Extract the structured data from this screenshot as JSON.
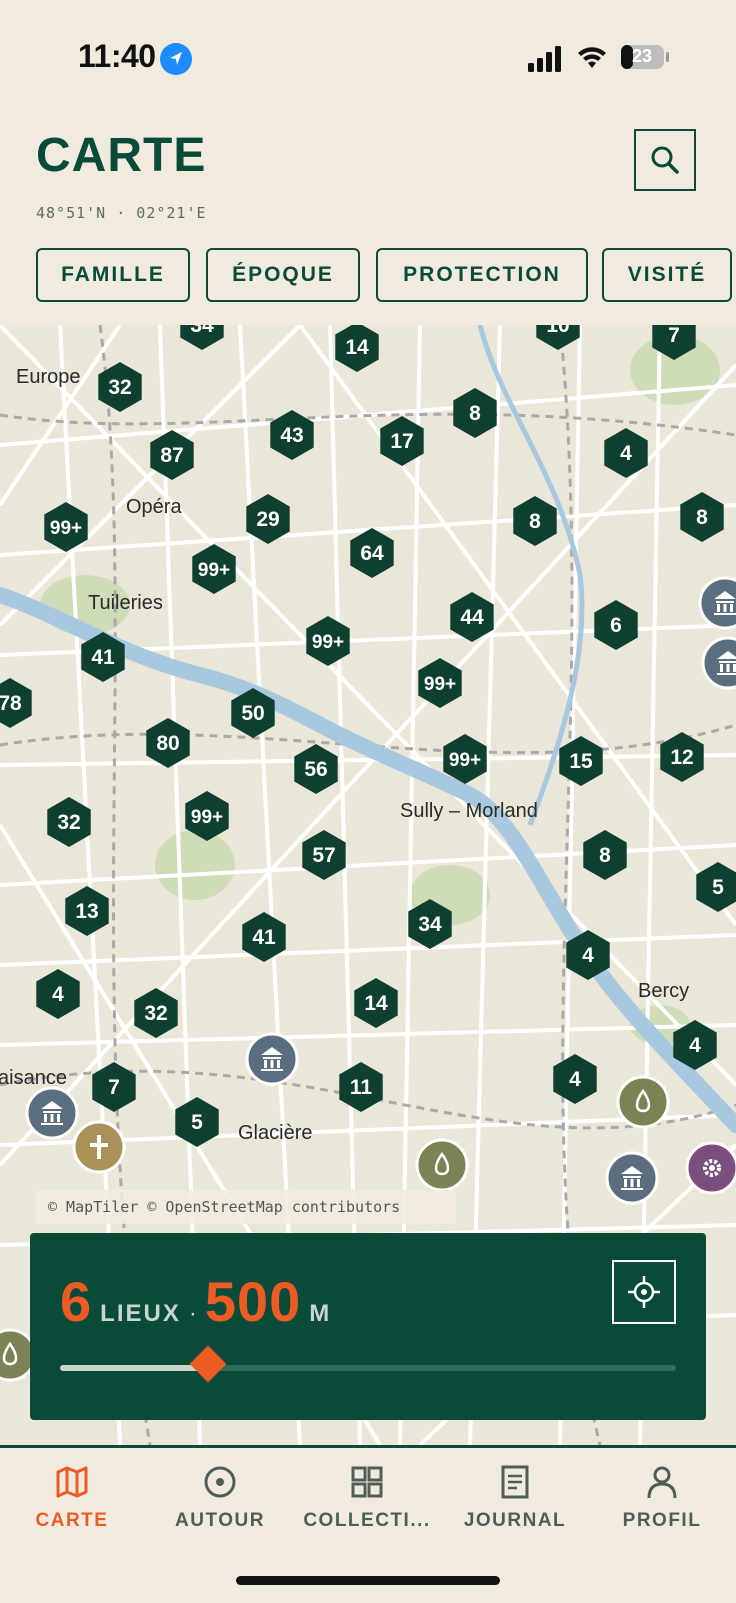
{
  "status_bar": {
    "time": "11:40",
    "battery": "23",
    "icons": [
      "location-arrow-icon",
      "signal-icon",
      "wifi-icon",
      "battery-icon"
    ]
  },
  "header": {
    "title": "CARTE",
    "coords": "48°51'N · 02°21'E",
    "search_icon": "search-icon"
  },
  "filters": [
    {
      "label": "FAMILLE"
    },
    {
      "label": "ÉPOQUE"
    },
    {
      "label": "PROTECTION"
    },
    {
      "label": "VISITÉ"
    }
  ],
  "map": {
    "place_labels": [
      "Europe",
      "Opéra",
      "Tuileries",
      "Sully – Morland",
      "Bercy",
      "Glacière",
      "aisance"
    ],
    "clusters": [
      "34",
      "14",
      "10",
      "7",
      "32",
      "87",
      "43",
      "17",
      "8",
      "4",
      "99+",
      "29",
      "64",
      "8",
      "8",
      "99+",
      "44",
      "6",
      "41",
      "99+",
      "99+",
      "78",
      "50",
      "80",
      "56",
      "99+",
      "15",
      "12",
      "32",
      "99+",
      "57",
      "8",
      "5",
      "13",
      "41",
      "34",
      "4",
      "4",
      "32",
      "14",
      "4",
      "7",
      "11",
      "5",
      "4"
    ],
    "attribution": "© MapTiler © OpenStreetMap contributors",
    "water_color": "#a8c8e0",
    "park_color": "#cfdcb8"
  },
  "radius_panel": {
    "places_count": "6",
    "places_unit": "LIEUX",
    "separator": "·",
    "distance_value": "500",
    "distance_unit": "M",
    "slider_value": 0.24,
    "locate_icon": "crosshair-icon"
  },
  "tabs": [
    {
      "label": "CARTE",
      "icon": "map-icon",
      "active": true
    },
    {
      "label": "AUTOUR",
      "icon": "target-icon",
      "active": false
    },
    {
      "label": "COLLECTI...",
      "icon": "grid-icon",
      "active": false
    },
    {
      "label": "JOURNAL",
      "icon": "journal-icon",
      "active": false
    },
    {
      "label": "PROFIL",
      "icon": "user-icon",
      "active": false
    }
  ],
  "colors": {
    "accent": "#ee5b25",
    "brand": "#0a4a38",
    "background": "#f1ebdf"
  }
}
